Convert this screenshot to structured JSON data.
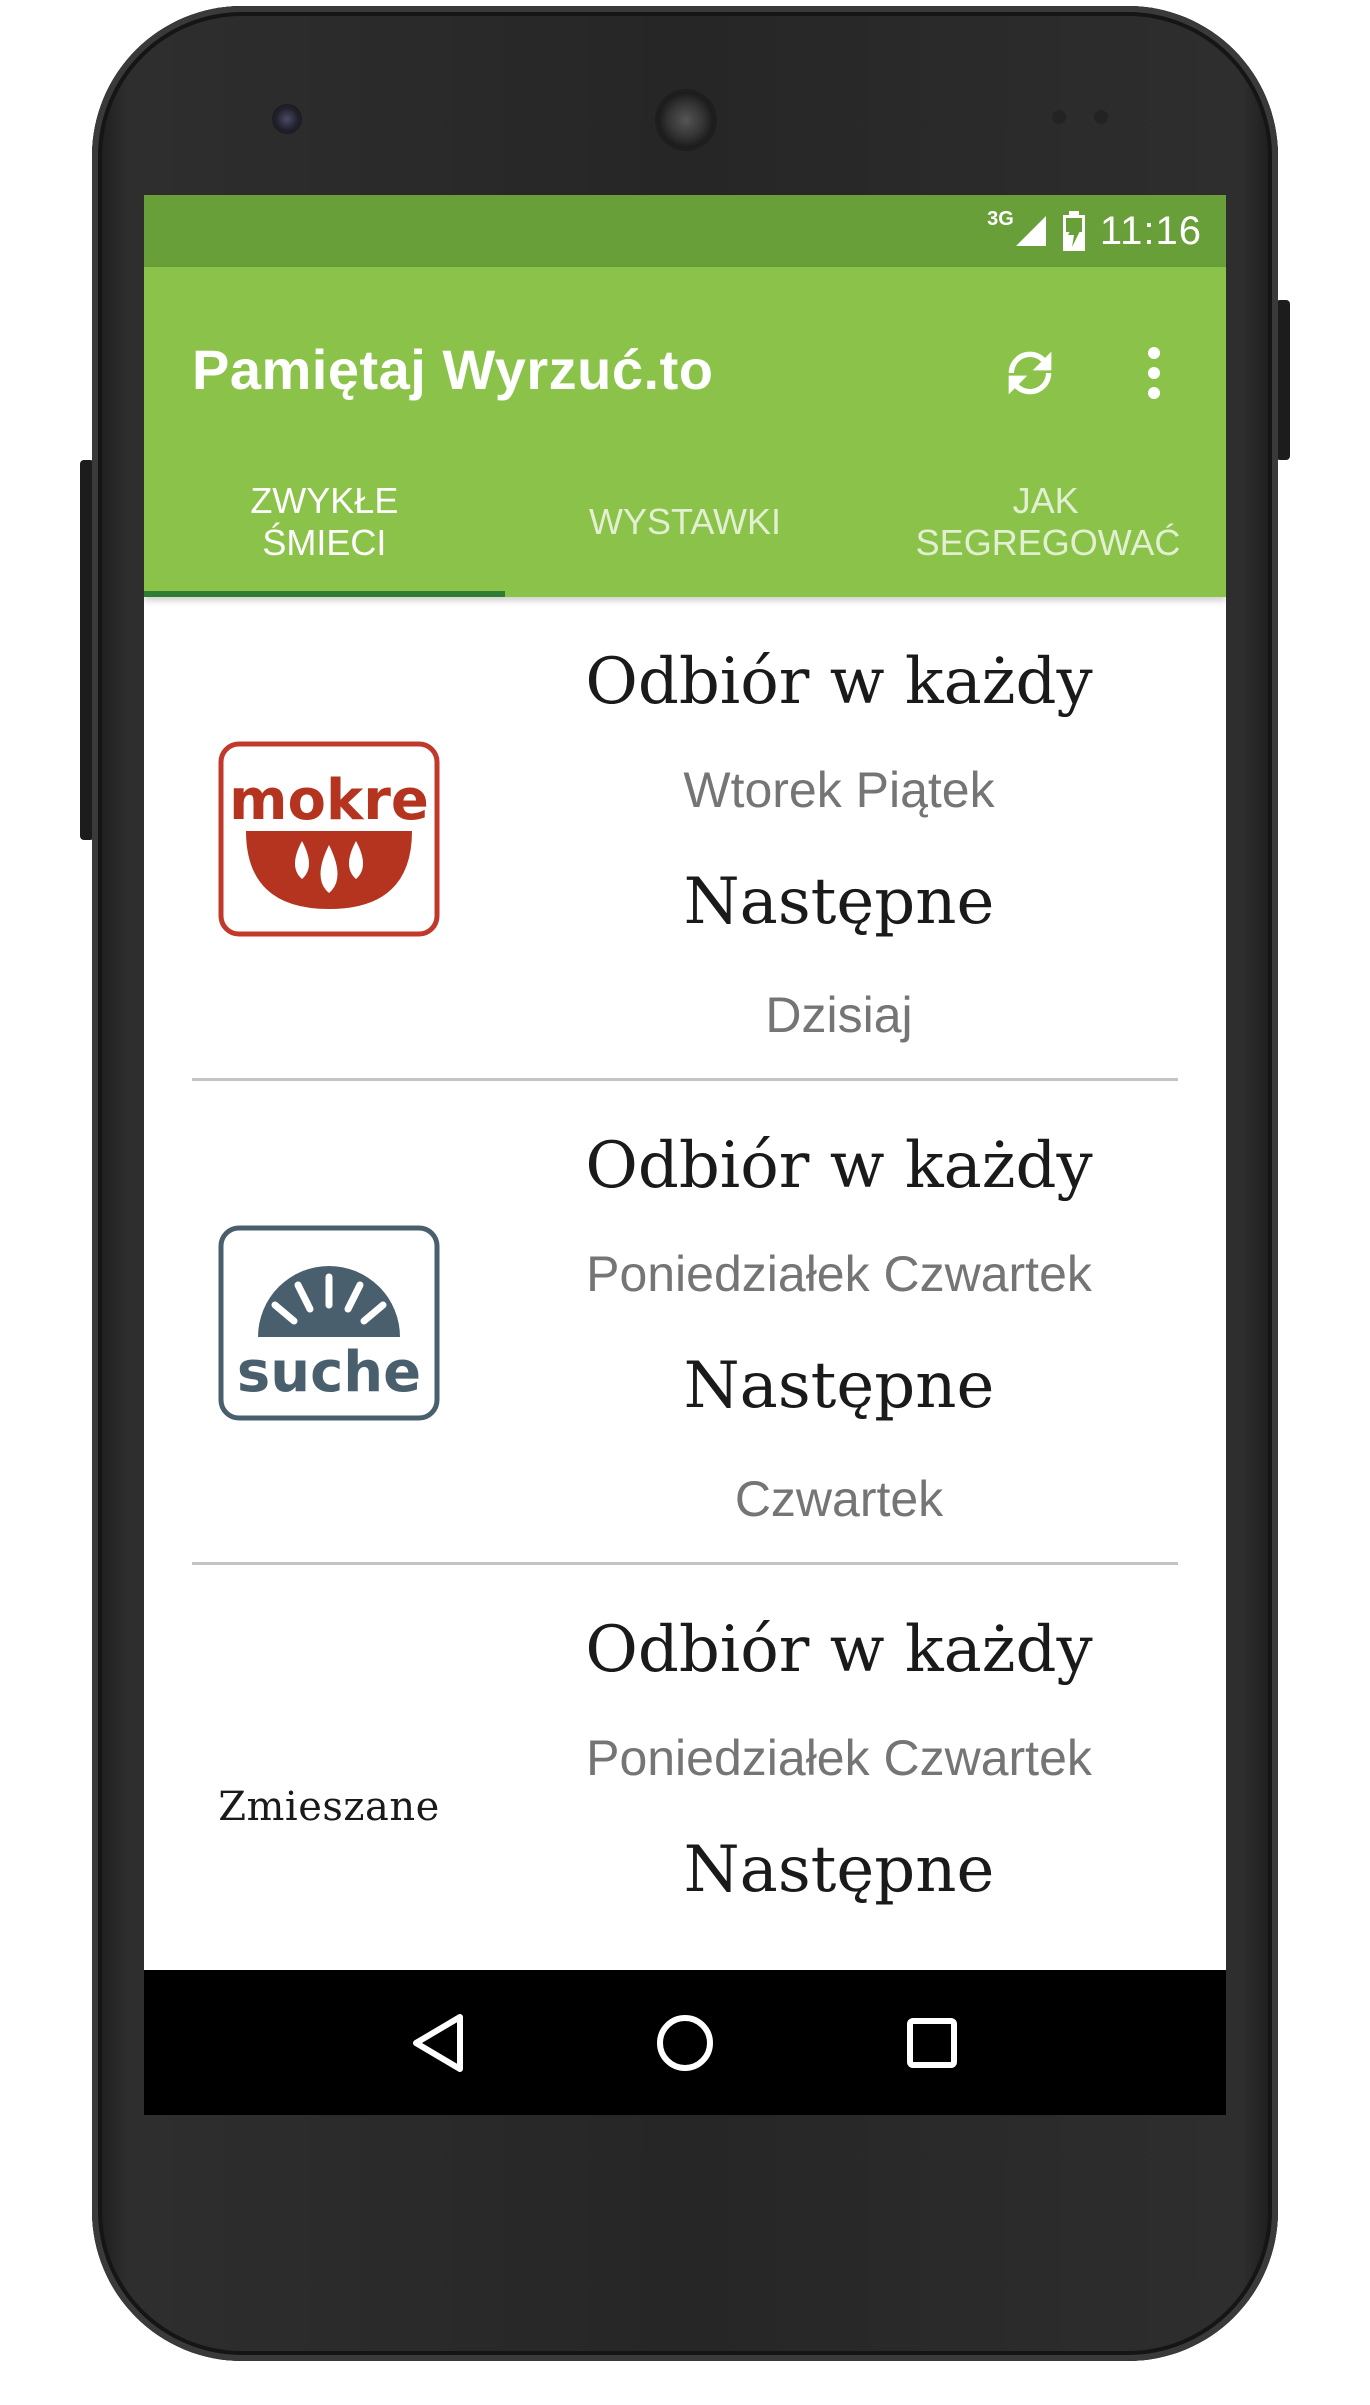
{
  "status_bar": {
    "network_type": "3G",
    "time": "11:16",
    "color": "#689f38"
  },
  "app_bar": {
    "title": "Pamiętaj Wyrzuć.to",
    "color": "#8bc34a",
    "actions": {
      "refresh_icon": "refresh-icon",
      "more_icon": "more-vert-icon"
    }
  },
  "tabs": [
    {
      "label": "ZWYKŁE ŚMIECI",
      "active": true
    },
    {
      "label": "WYSTAWKI",
      "active": false
    },
    {
      "label": "JAK\nSEGREGOWAĆ",
      "active": false
    }
  ],
  "items": [
    {
      "logo": "mokre",
      "logo_text": "mokre",
      "heading": "Odbiór w każdy",
      "days": "Wtorek Piątek",
      "next_heading": "Następne",
      "next_value": "Dzisiaj"
    },
    {
      "logo": "suche",
      "logo_text": "suche",
      "heading": "Odbiór w każdy",
      "days": "Poniedziałek Czwartek",
      "next_heading": "Następne",
      "next_value": "Czwartek"
    },
    {
      "logo": "zmieszane",
      "logo_text": "Zmieszane",
      "heading": "Odbiór w każdy",
      "days": "Poniedziałek Czwartek",
      "next_heading": "Następne",
      "next_value": ""
    }
  ],
  "nav_bar": {
    "back_icon": "back-icon",
    "home_icon": "home-icon",
    "recents_icon": "recents-icon"
  }
}
